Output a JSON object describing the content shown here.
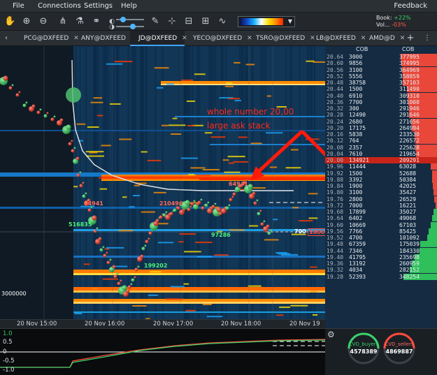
{
  "menu": {
    "items": [
      "File",
      "Connections",
      "Settings",
      "Help"
    ],
    "feedback": "Feedback"
  },
  "toolbar": {
    "book_label": "Book:",
    "book_change": "+22%",
    "volume_label": "Vol...",
    "volume_change": "-03%",
    "heatmap_gradient_colors": [
      "#0a1240",
      "#1448c8",
      "#18b4ff",
      "#ffffff",
      "#ffe000",
      "#ff8a00",
      "#ff2000"
    ]
  },
  "tabs": [
    {
      "label": "PCG@DXFEED",
      "active": false
    },
    {
      "label": "ANY@DXFEED",
      "active": false
    },
    {
      "label": "JD@DXFEED",
      "active": true
    },
    {
      "label": "YECO@DXFEED",
      "active": false
    },
    {
      "label": "TSRO@DXFEED",
      "active": false
    },
    {
      "label": "LB@DXFEED",
      "active": false
    },
    {
      "label": "AMD@D",
      "active": false
    }
  ],
  "dom": {
    "header_col": "COB",
    "header_cob": "COB",
    "rows": [
      {
        "price": "20.64",
        "size": "3000",
        "cob": "377995",
        "side": "ask"
      },
      {
        "price": "20.60",
        "size": "9856",
        "cob": "374995",
        "side": "ask"
      },
      {
        "price": "20.56",
        "size": "3100",
        "cob": "364969",
        "side": "ask"
      },
      {
        "price": "20.52",
        "size": "5556",
        "cob": "358859",
        "side": "ask"
      },
      {
        "price": "20.48",
        "size": "38758",
        "cob": "357103",
        "side": "ask"
      },
      {
        "price": "20.44",
        "size": "1500",
        "cob": "311490",
        "side": "ask"
      },
      {
        "price": "20.40",
        "size": "6910",
        "cob": "309310",
        "side": "ask"
      },
      {
        "price": "20.36",
        "size": "7700",
        "cob": "301000",
        "side": "ask"
      },
      {
        "price": "20.32",
        "size": "300",
        "cob": "291946",
        "side": "ask"
      },
      {
        "price": "20.28",
        "size": "12490",
        "cob": "291646",
        "side": "ask"
      },
      {
        "price": "20.24",
        "size": "2680",
        "cob": "271656",
        "side": "ask"
      },
      {
        "price": "20.20",
        "size": "17175",
        "cob": "264994",
        "side": "ask"
      },
      {
        "price": "20.16",
        "size": "5838",
        "cob": "233530",
        "side": "ask"
      },
      {
        "price": "20.12",
        "size": "764",
        "cob": "226572",
        "side": "ask"
      },
      {
        "price": "20.08",
        "size": "2357",
        "cob": "225628",
        "side": "ask"
      },
      {
        "price": "20.04",
        "size": "7610",
        "cob": "219654",
        "side": "ask"
      },
      {
        "price": "20.00",
        "size": "134921",
        "cob": "209291",
        "side": "ask"
      },
      {
        "price": "19.96",
        "size": "11444",
        "cob": "63028",
        "side": "ask"
      },
      {
        "price": "19.92",
        "size": "1500",
        "cob": "52688",
        "side": "ask"
      },
      {
        "price": "19.88",
        "size": "3392",
        "cob": "50384",
        "side": "ask"
      },
      {
        "price": "19.84",
        "size": "1900",
        "cob": "42025",
        "side": "ask"
      },
      {
        "price": "19.80",
        "size": "3100",
        "cob": "35427",
        "side": "ask"
      },
      {
        "price": "19.76",
        "size": "2800",
        "cob": "26529",
        "side": "ask"
      },
      {
        "price": "19.72",
        "size": "7000",
        "cob": "16221",
        "side": "ask"
      },
      {
        "price": "19.68",
        "size": "17899",
        "cob": "35027",
        "side": "bid"
      },
      {
        "price": "19.64",
        "size": "6402",
        "cob": "49068",
        "side": "bid"
      },
      {
        "price": "19.60",
        "size": "10669",
        "cob": "67103",
        "side": "bid"
      },
      {
        "price": "19.56",
        "size": "7766",
        "cob": "85425",
        "side": "bid"
      },
      {
        "price": "19.52",
        "size": "4700",
        "cob": "101092",
        "side": "bid"
      },
      {
        "price": "19.48",
        "size": "67359",
        "cob": "175039",
        "side": "bid"
      },
      {
        "price": "19.44",
        "size": "7346",
        "cob": "184330",
        "side": "bid"
      },
      {
        "price": "19.40",
        "size": "41795",
        "cob": "235698",
        "side": "bid"
      },
      {
        "price": "19.36",
        "size": "13192",
        "cob": "260959",
        "side": "bid"
      },
      {
        "price": "19.32",
        "size": "4034",
        "cob": "282152",
        "side": "bid"
      },
      {
        "price": "19.28",
        "size": "52393",
        "cob": "348254",
        "side": "bid"
      }
    ]
  },
  "annotation": {
    "line1": "whole number 20,00",
    "line2": "large ask stack"
  },
  "chart_labels": {
    "trade_1": "210496",
    "trade_2": "516835",
    "trade_3": "97286",
    "trade_4": "199202",
    "trade_5": "64941",
    "trade_6": "64941",
    "level_ask": "700",
    "level_bid": "1000",
    "left_level": "3000000"
  },
  "time_axis": [
    "20 Nov 15:00",
    "20 Nov 16:00",
    "20 Nov 17:00",
    "20 Nov 18:00",
    "20 Nov 19"
  ],
  "indicator": {
    "labels": [
      "1.0",
      "0.5",
      "0",
      "-0.5",
      "-1.0"
    ],
    "cvd_buyers_label": "CVD_buyers",
    "cvd_buyers_value": "4578389",
    "cvd_sellers_label": "CVD_sellers",
    "cvd_sellers_value": "4869887",
    "buyers_color": "#3ad16b",
    "sellers_color": "#ff4a3a"
  }
}
